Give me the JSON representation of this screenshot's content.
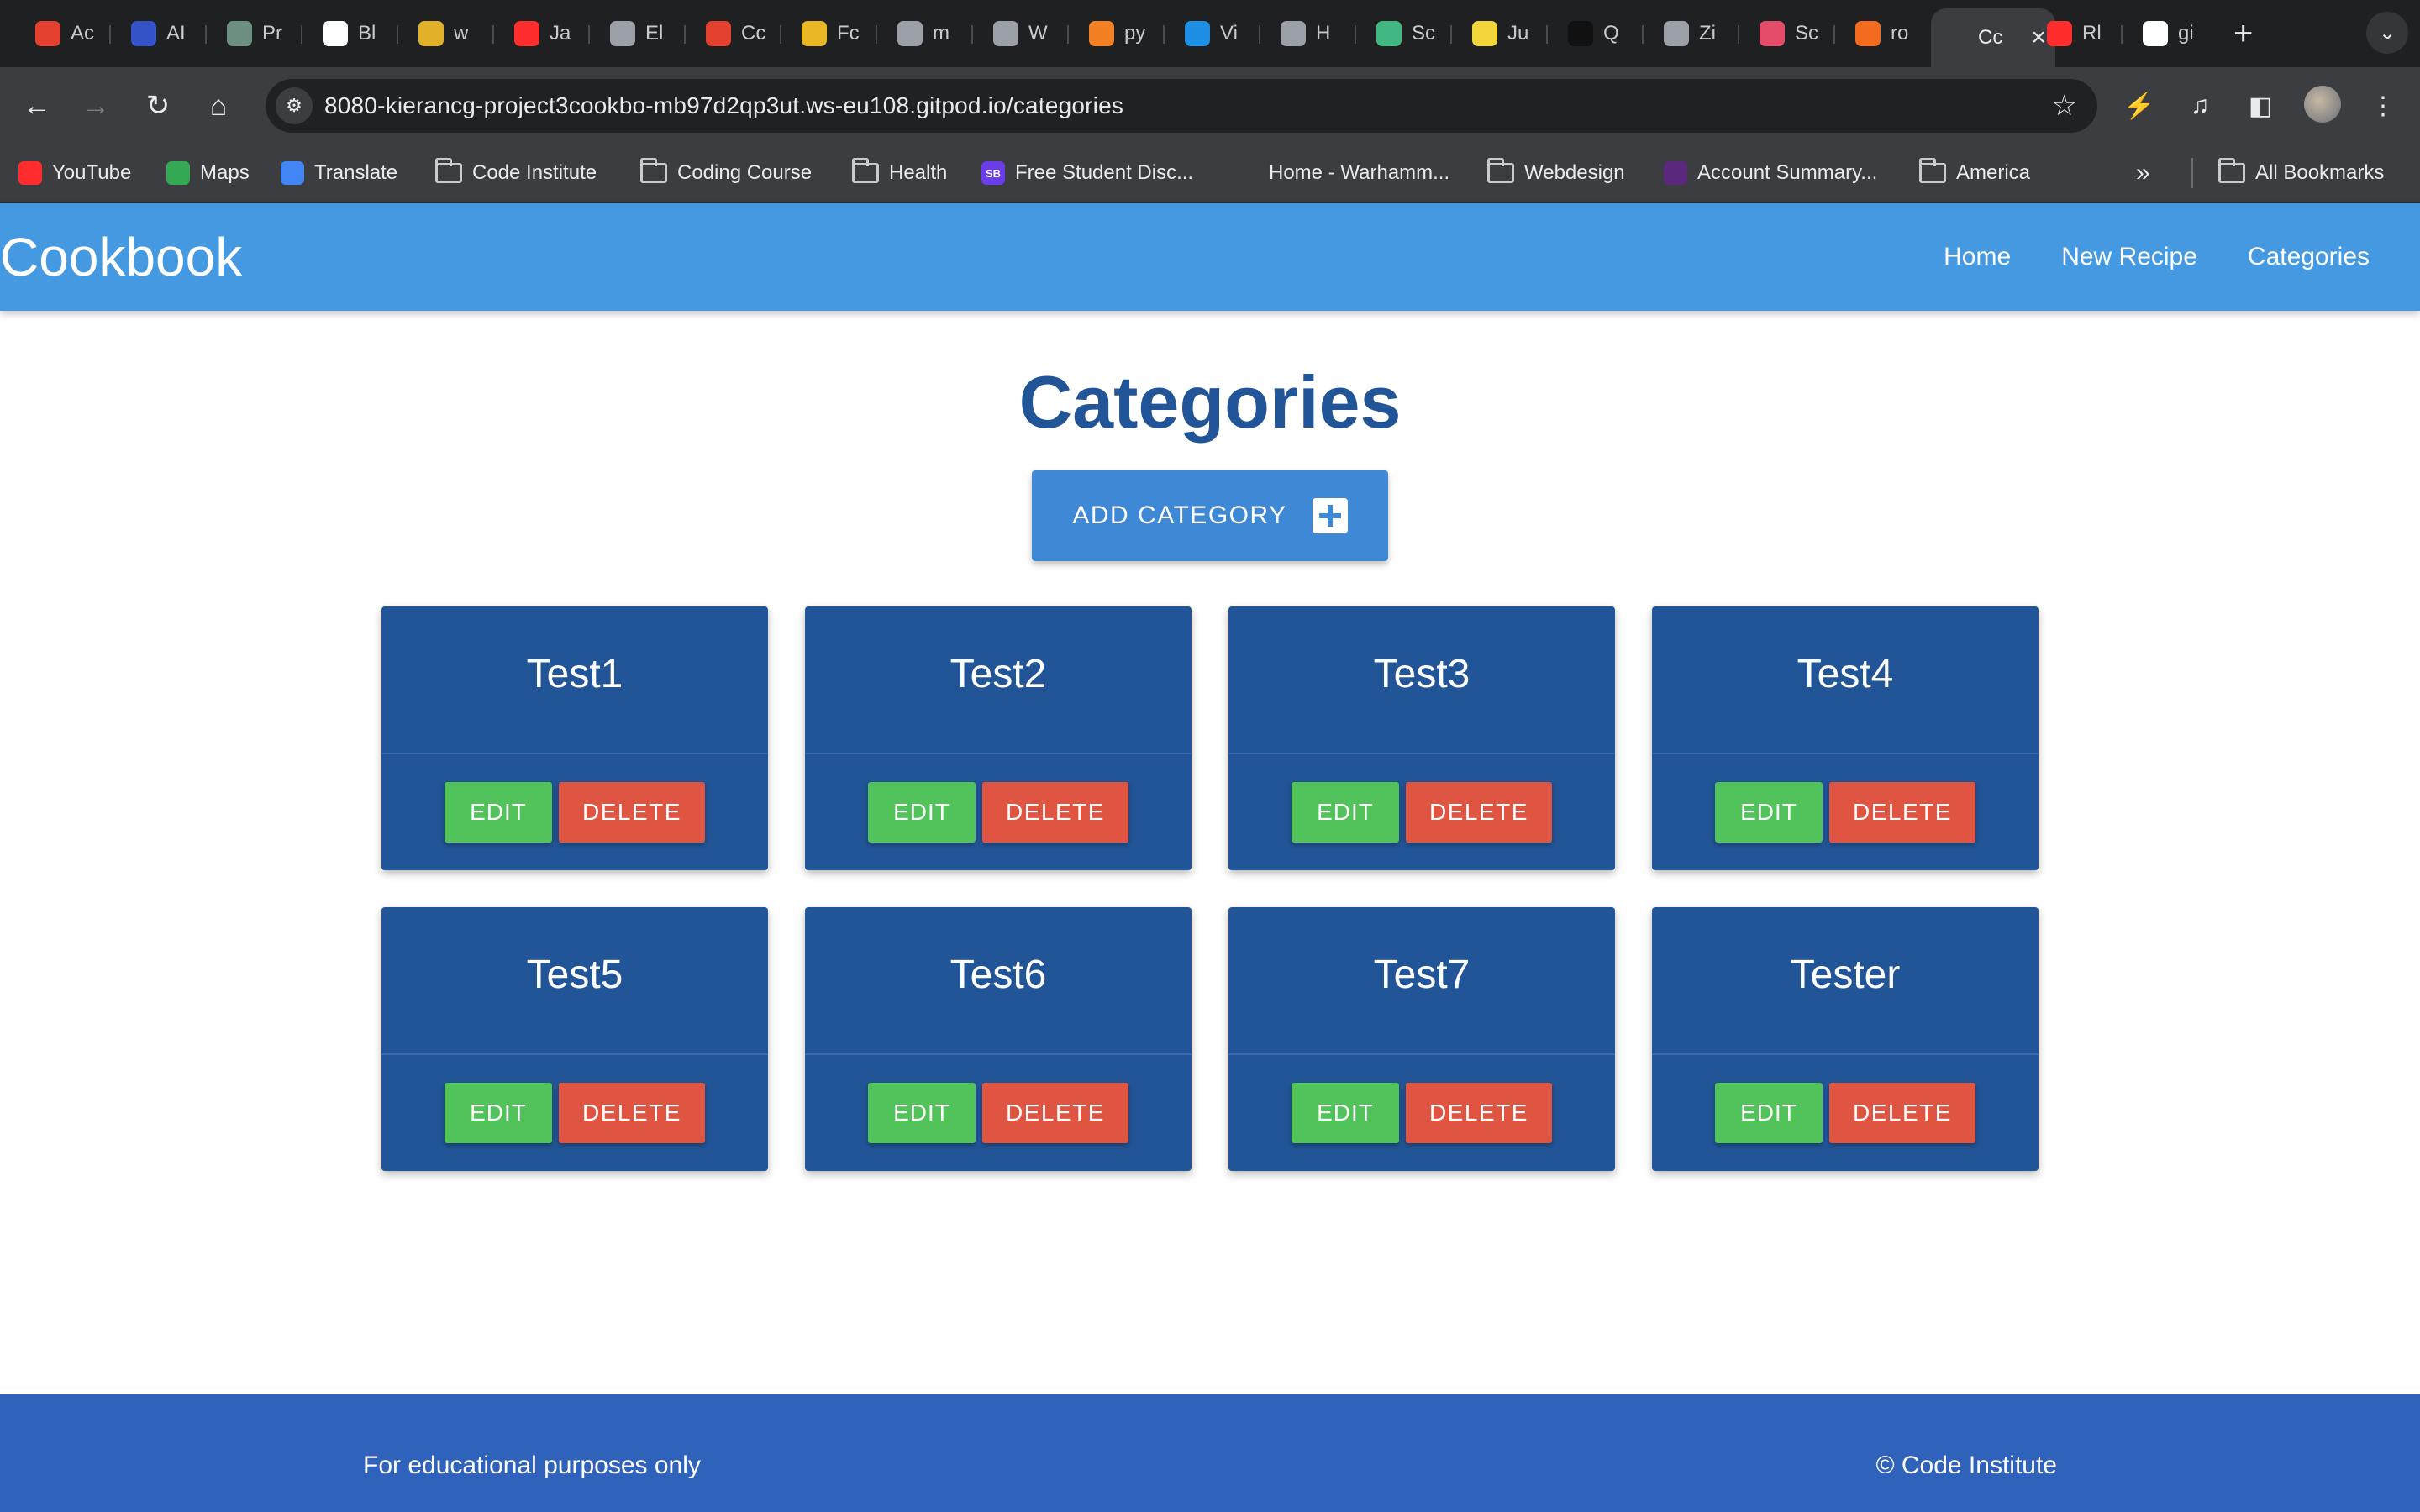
{
  "browser": {
    "tabs": [
      {
        "label": "Ac",
        "icon": "opera-icon",
        "color": "#e4402f"
      },
      {
        "label": "AI",
        "icon": "api-icon",
        "color": "#3553c9"
      },
      {
        "label": "Pr",
        "icon": "chatgpt-icon",
        "color": "#6c8f80"
      },
      {
        "label": "Bl",
        "icon": "blog-icon",
        "color": "#ffffff"
      },
      {
        "label": "w",
        "icon": "colorbar-icon",
        "color": "#e2b12a"
      },
      {
        "label": "Ja",
        "icon": "youtube-icon",
        "color": "#ff2d2d"
      },
      {
        "label": "El",
        "icon": "globe-icon",
        "color": "#9aa0a6"
      },
      {
        "label": "Cc",
        "icon": "codepen-icon",
        "color": "#e4402f"
      },
      {
        "label": "Fc",
        "icon": "firebase-icon",
        "color": "#e8b723"
      },
      {
        "label": "m",
        "icon": "globe-icon",
        "color": "#9aa0a6"
      },
      {
        "label": "W",
        "icon": "globe-icon",
        "color": "#9aa0a6"
      },
      {
        "label": "py",
        "icon": "stackoverflow-icon",
        "color": "#f48024"
      },
      {
        "label": "Vi",
        "icon": "vscode-icon",
        "color": "#1f8fe5"
      },
      {
        "label": "H",
        "icon": "news-icon",
        "color": "#9aa0a6"
      },
      {
        "label": "Sc",
        "icon": "vue-icon",
        "color": "#41b883"
      },
      {
        "label": "Ju",
        "icon": "otta-icon",
        "color": "#f2d63a"
      },
      {
        "label": "Q",
        "icon": "indeed-icon",
        "color": "#111111"
      },
      {
        "label": "Zi",
        "icon": "spiral-icon",
        "color": "#9aa0a6"
      },
      {
        "label": "Sc",
        "icon": "wave-icon",
        "color": "#e44c6a"
      },
      {
        "label": "ro",
        "icon": "g-icon",
        "color": "#f26b1f"
      },
      {
        "label": "Cc",
        "icon": "cookbook-icon",
        "color": "#3b3d40",
        "active": true
      },
      {
        "label": "Rl",
        "icon": "youtube-icon",
        "color": "#ff2d2d"
      },
      {
        "label": "gi",
        "icon": "github-icon",
        "color": "#ffffff"
      }
    ],
    "url": "8080-kierancg-project3cookbo-mb97d2qp3ut.ws-eu108.gitpod.io/categories",
    "bookmarks": [
      {
        "label": "YouTube",
        "type": "site",
        "icon": "youtube-icon",
        "color": "#ff2d2d"
      },
      {
        "label": "Maps",
        "type": "site",
        "icon": "maps-pin-icon",
        "color": "#34a853"
      },
      {
        "label": "Translate",
        "type": "site",
        "icon": "translate-icon",
        "color": "#4285f4"
      },
      {
        "label": "Code Institute",
        "type": "folder"
      },
      {
        "label": "Coding Course",
        "type": "folder"
      },
      {
        "label": "Health",
        "type": "folder"
      },
      {
        "label": "Free Student Disc...",
        "type": "site",
        "icon": "sb-icon",
        "color": "#6a3de8",
        "glyph": "SB"
      },
      {
        "label": "Home - Warhamm...",
        "type": "site",
        "icon": "warhammer-icon",
        "color": "#3b3d40"
      },
      {
        "label": "Webdesign",
        "type": "folder"
      },
      {
        "label": "Account Summary...",
        "type": "site",
        "icon": "natwest-icon",
        "color": "#5a287d"
      },
      {
        "label": "America",
        "type": "folder"
      }
    ],
    "all_bookmarks": "All Bookmarks"
  },
  "site": {
    "brand": "Cookbook",
    "nav": [
      "Home",
      "New Recipe",
      "Categories"
    ]
  },
  "main": {
    "title": "Categories",
    "add_button": "ADD CATEGORY",
    "edit_label": "EDIT",
    "delete_label": "DELETE",
    "categories": [
      "Test1",
      "Test2",
      "Test3",
      "Test4",
      "Test5",
      "Test6",
      "Test7",
      "Tester"
    ]
  },
  "footer": {
    "left": "For educational purposes only",
    "right": "© Code Institute"
  },
  "colors": {
    "navbar": "#4599e0",
    "card": "#225597",
    "edit": "#52c25a",
    "delete": "#e05442",
    "footer": "#2f62ba"
  }
}
